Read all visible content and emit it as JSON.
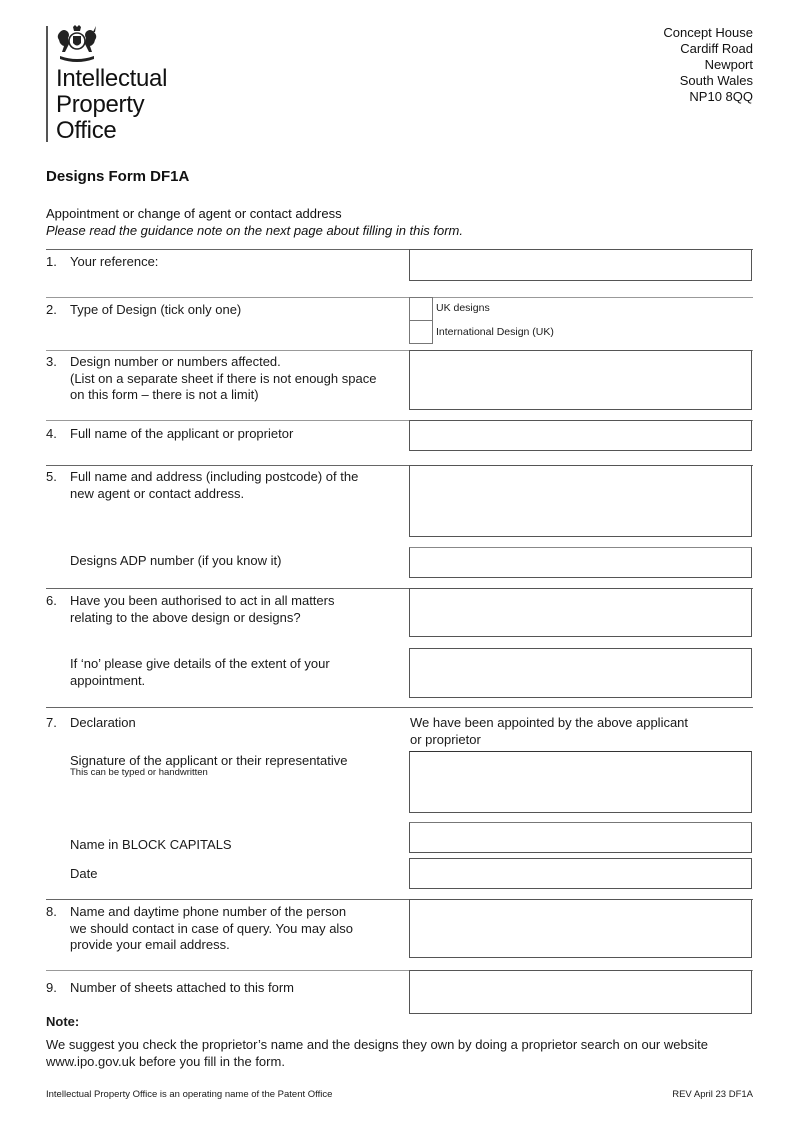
{
  "header": {
    "logo_lines": [
      "Intellectual",
      "Property",
      "Office"
    ],
    "address_lines": [
      "Concept House",
      "Cardiff Road",
      "Newport",
      "South Wales",
      "NP10 8QQ"
    ]
  },
  "form": {
    "title": "Designs Form DF1A",
    "subtitle": "Appointment or change of agent or contact address",
    "guidance": "Please read the guidance note on the next page about filling in this form."
  },
  "sections": {
    "s1": {
      "number": "1.",
      "label": "Your reference:",
      "value": ""
    },
    "s2": {
      "number": "2.",
      "label": "Type of Design (tick only one)",
      "options": [
        {
          "label": "UK designs",
          "checked": false
        },
        {
          "label": "International Design (UK)",
          "checked": false
        }
      ]
    },
    "s3": {
      "number": "3.",
      "label_lines": [
        "Design number or numbers affected.",
        "(List on a separate sheet if there is not enough space",
        "on this form – there is not a limit)"
      ],
      "value": ""
    },
    "s4": {
      "number": "4.",
      "label": "Full name of the applicant or proprietor",
      "value": ""
    },
    "s5": {
      "number": "5.",
      "label_lines": [
        "Full name and address (including postcode) of the",
        "new agent or contact address."
      ],
      "value": "",
      "adp_label": "Designs ADP number (if you know it)",
      "adp_value": ""
    },
    "s6": {
      "number": "6.",
      "label_lines": [
        "Have you been authorised to act in all matters",
        "relating to the above design or designs?"
      ],
      "value": "",
      "extent_label_lines": [
        "If ‘no’ please give details of the extent of your",
        "appointment."
      ],
      "extent_value": ""
    },
    "s7": {
      "number": "7.",
      "label": "Declaration",
      "declaration_lines": [
        "We have been appointed by the above applicant",
        "or proprietor"
      ],
      "signature_label": "Signature of the applicant or their representative",
      "signature_hint": "This can be typed or handwritten",
      "signature_value": "",
      "name_label": "Name in BLOCK CAPITALS",
      "name_value": "",
      "date_label": "Date",
      "date_value": ""
    },
    "s8": {
      "number": "8.",
      "label_lines": [
        "Name and daytime phone number of the person",
        "we should contact in case of query. You may also",
        "provide your email address."
      ],
      "value": ""
    },
    "s9": {
      "number": "9.",
      "label": "Number of sheets attached to this form",
      "value": ""
    }
  },
  "note": {
    "title": "Note:",
    "lines": [
      "We suggest you check the proprietor’s name and the designs they own by doing a proprietor search on our website",
      "www.ipo.gov.uk before you fill in the form."
    ]
  },
  "footer": {
    "left": "Intellectual Property Office is an operating name of the Patent Office",
    "right": "REV April 23 DF1A"
  }
}
